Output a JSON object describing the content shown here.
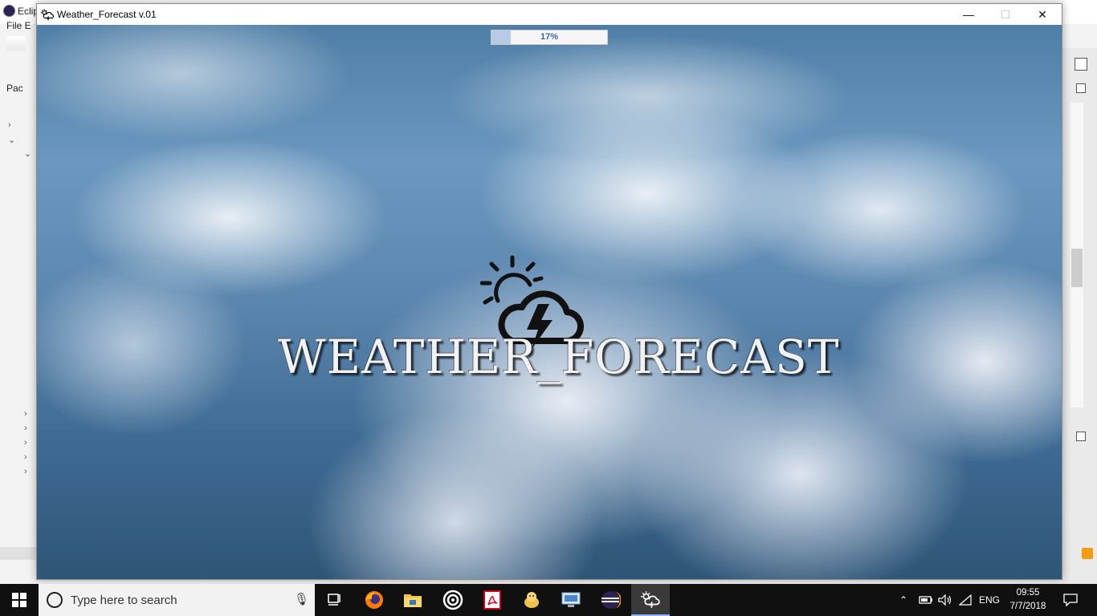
{
  "eclipse": {
    "title_partial": "Eclip",
    "menu_partial": "File  E",
    "view_partial": "Pac"
  },
  "window": {
    "title": "Weather_Forecast v.01",
    "minimize_label": "—",
    "maximize_label": "☐",
    "close_label": "✕"
  },
  "splash": {
    "progress_percent": 17,
    "progress_label": "17%",
    "brand_text": "WEATHER_FORECAST"
  },
  "taskbar": {
    "search_placeholder": "Type here to search",
    "apps": [
      "task-view",
      "firefox",
      "file-explorer",
      "media-app",
      "acrobat",
      "java-app",
      "remote-desktop",
      "eclipse",
      "weather-forecast"
    ],
    "language": "ENG",
    "time": "09:55",
    "date": "7/7/2018"
  },
  "colors": {
    "progress_fill": "#b7cbe6",
    "progress_text": "#3b6aa0",
    "taskbar_bg": "#101010"
  }
}
